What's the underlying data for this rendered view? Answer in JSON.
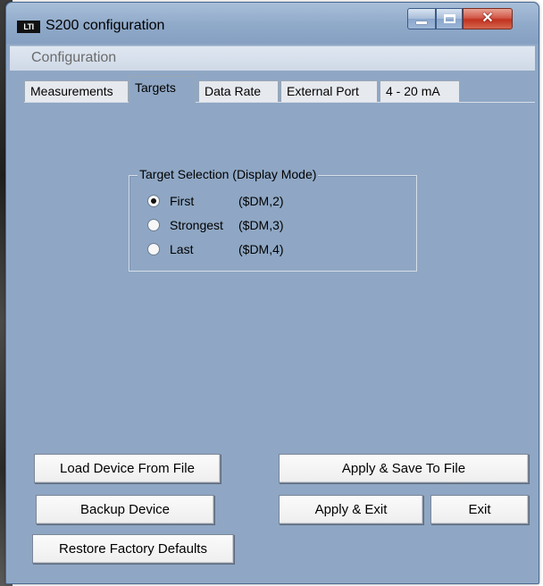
{
  "window": {
    "title": "S200 configuration",
    "app_icon_text": "LTI",
    "controls": {
      "minimize": "minimize",
      "maximize": "maximize",
      "close": "✕"
    }
  },
  "menu": {
    "items": [
      {
        "label": "Configuration"
      }
    ]
  },
  "tabs": [
    {
      "label": "Measurements",
      "active": false
    },
    {
      "label": "Targets",
      "active": true
    },
    {
      "label": "Data Rate",
      "active": false
    },
    {
      "label": "External Port",
      "active": false
    },
    {
      "label": "4 - 20 mA",
      "active": false
    }
  ],
  "target_selection": {
    "title": "Target Selection (Display Mode)",
    "options": [
      {
        "label": "First",
        "code": "($DM,2)",
        "checked": true
      },
      {
        "label": "Strongest",
        "code": "($DM,3)",
        "checked": false
      },
      {
        "label": "Last",
        "code": "($DM,4)",
        "checked": false
      }
    ]
  },
  "buttons": {
    "load_device": "Load Device From File",
    "apply_save": "Apply & Save To File",
    "backup_device": "Backup Device",
    "apply_exit": "Apply & Exit",
    "exit": "Exit",
    "restore_defaults": "Restore Factory Defaults"
  },
  "colors": {
    "window_background": "#8fa7c4",
    "close_button": "#c2321f",
    "tab_inactive": "#e6e9ee"
  }
}
